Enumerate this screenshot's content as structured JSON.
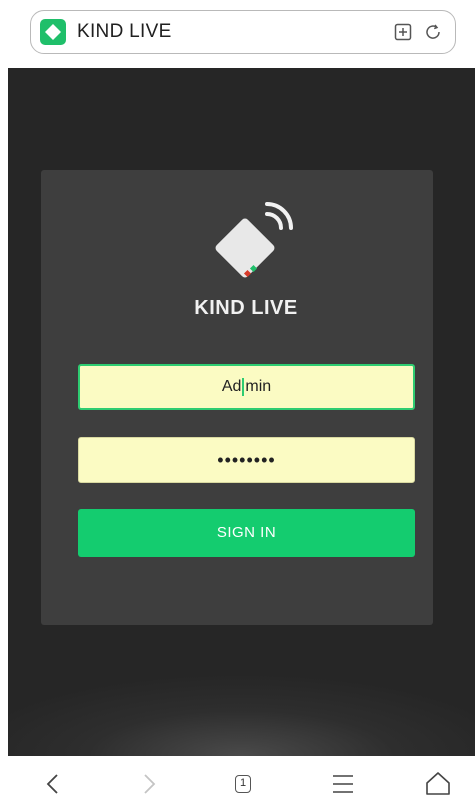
{
  "browser": {
    "site_title": "KIND LIVE",
    "icons": [
      "site-logo-icon",
      "bookmark-add-icon",
      "reload-icon"
    ]
  },
  "login": {
    "brand": "KIND LIVE",
    "username_value_before_caret": "Ad",
    "username_value_after_caret": "min",
    "password_masked": "••••••••",
    "sign_in_label": "SIGN IN"
  },
  "bottom_nav": {
    "tab_count": "1",
    "icons": [
      "back-icon",
      "forward-icon",
      "tabs-icon",
      "menu-icon",
      "home-icon"
    ]
  },
  "colors": {
    "accent_green": "#14cc6f",
    "input_background": "#fbfbc3",
    "card_background": "#3e3e3e",
    "page_background": "#262626"
  }
}
